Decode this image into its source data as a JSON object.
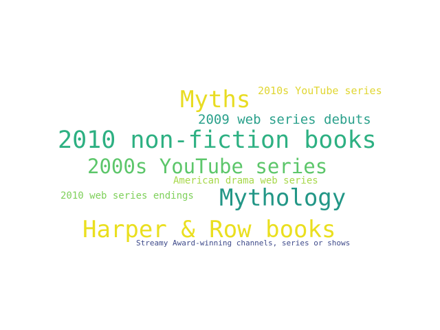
{
  "words": [
    {
      "id": "w-myths",
      "text": "Myths",
      "color": "#e8dc22"
    },
    {
      "id": "w-2010s-youtube",
      "text": "2010s YouTube series",
      "color": "#e0d632"
    },
    {
      "id": "w-2009-debuts",
      "text": "2009 web series debuts",
      "color": "#2aa08b"
    },
    {
      "id": "w-2010-nonfiction",
      "text": "2010 non-fiction books",
      "color": "#2db082"
    },
    {
      "id": "w-2000s-youtube",
      "text": "2000s YouTube series",
      "color": "#5cc66a"
    },
    {
      "id": "w-american-drama",
      "text": "American drama web series",
      "color": "#a7d84a"
    },
    {
      "id": "w-2010-endings",
      "text": "2010 web series endings",
      "color": "#7ed05a"
    },
    {
      "id": "w-mythology",
      "text": "Mythology",
      "color": "#229686"
    },
    {
      "id": "w-harper-row",
      "text": "Harper & Row books",
      "color": "#eadf1f"
    },
    {
      "id": "w-streamy",
      "text": "Streamy Award-winning channels, series or shows",
      "color": "#3e4a8a"
    }
  ]
}
